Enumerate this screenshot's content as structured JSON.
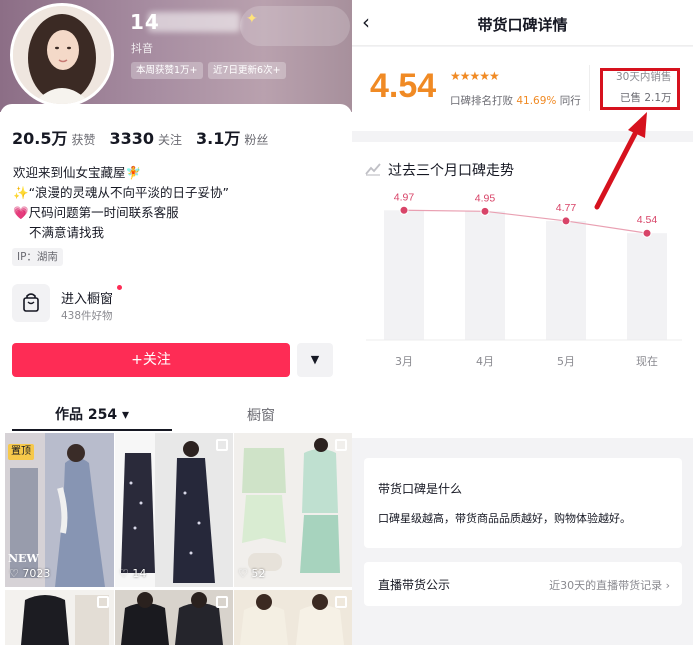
{
  "profile": {
    "nickname": "14",
    "platform": "抖音",
    "tags": [
      "本周获赞1万+",
      "近7日更新6次+"
    ],
    "stats": [
      {
        "value": "20.5万",
        "label": "获赞"
      },
      {
        "value": "3330",
        "label": "关注"
      },
      {
        "value": "3.1万",
        "label": "粉丝"
      }
    ],
    "bio": [
      "欢迎来到仙女宝藏屋🧚",
      "✨“浪漫的灵魂从不向平淡的日子妥协”",
      "💗尺码问题第一时间联系客服",
      "  不满意请找我"
    ],
    "ip": "IP：湖南",
    "shop_title": "进入橱窗",
    "shop_sub": "438件好物",
    "follow_label": "+关注",
    "more_label": "▼",
    "tab_works": "作品 254 ▾",
    "tab_window": "橱窗",
    "pinned_badge": "置顶",
    "grid_likes": [
      "7023",
      "14",
      "52"
    ],
    "new_text": "NEW"
  },
  "detail": {
    "title": "带货口碑详情",
    "back_icon": "‹",
    "score": "4.54",
    "stars": "★★★★★",
    "rank_prefix": "口碑排名打败",
    "rank_pct": "41.69%",
    "rank_suffix": "同行",
    "sales_label": "30天内销售",
    "sales_value": "已售 2.1万",
    "trend_title": "过去三个月口碑走势",
    "info_title": "带货口碑是什么",
    "info_body": "口碑星级越高，带货商品品质越好，购物体验越好。",
    "record_label": "直播带货公示",
    "record_link": "近30天的直播带货记录 ›"
  },
  "colors": {
    "brand_red": "#fe2c55",
    "score_orange": "#f08a24",
    "highlight_red": "#d6121e",
    "chart_point": "#d84468"
  },
  "chart_data": {
    "type": "line",
    "categories": [
      "3月",
      "4月",
      "5月",
      "现在"
    ],
    "values": [
      4.97,
      4.95,
      4.77,
      4.54
    ],
    "labels": [
      "4.97",
      "4.95",
      "4.77",
      "4.54"
    ],
    "ylim": [
      0,
      5.0
    ],
    "grid": false
  }
}
